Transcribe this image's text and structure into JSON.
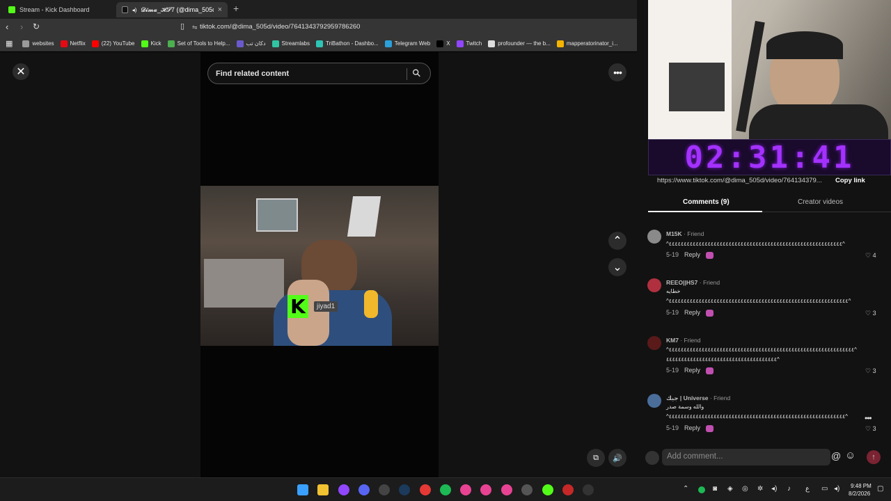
{
  "tabs": [
    {
      "title": "Stream - Kick Dashboard",
      "close": "×"
    },
    {
      "title": "𝓓𝓲𝓶𝓪_𝓗𝓢7 (@dima_505d) | T",
      "close": "×"
    }
  ],
  "new_tab": "+",
  "address": {
    "url": "tiktok.com/@dima_505d/video/7641343792959786260"
  },
  "bookmarks": [
    {
      "label": "websites",
      "color": "#9a9a9a"
    },
    {
      "label": "Netflix",
      "color": "#e50914"
    },
    {
      "label": "(22) YouTube",
      "color": "#ff0000"
    },
    {
      "label": "Kick",
      "color": "#53fc18"
    },
    {
      "label": "Set of Tools to Help...",
      "color": "#4caf50"
    },
    {
      "label": "دكان تب",
      "color": "#6a5acd"
    },
    {
      "label": "Streamlabs",
      "color": "#31c3a2"
    },
    {
      "label": "TriBathon - Dashbo...",
      "color": "#2ec4b6"
    },
    {
      "label": "Telegram Web",
      "color": "#2aa1da"
    },
    {
      "label": "X",
      "color": "#000000"
    },
    {
      "label": "Twitch",
      "color": "#9146ff"
    },
    {
      "label": "profounder — the b...",
      "color": "#dddddd"
    },
    {
      "label": "mapperatorinator_i...",
      "color": "#f4b400"
    }
  ],
  "search": {
    "placeholder": "Find related content"
  },
  "icons": {
    "close": "✕",
    "search": "⚲",
    "more": "•••",
    "up": "⌃",
    "down": "⌄",
    "sound": "🔊",
    "device": "⧉",
    "at": "@",
    "smile": "☺",
    "post": "↑",
    "like": "♡"
  },
  "overlay": {
    "kick_letter": "K",
    "kick_username": "jiyad1"
  },
  "timer": "02:31:41",
  "share": {
    "link": "https://www.tiktok.com/@dima_505d/video/764134379...",
    "copy_label": "Copy link"
  },
  "panel_tabs": {
    "comments": "Comments (9)",
    "creator": "Creator videos"
  },
  "comments": [
    {
      "user": "M15K",
      "relation": "· Friend",
      "lines": [
        "^٤٤٤٤٤٤٤٤٤٤٤٤٤٤٤٤٤٤٤٤٤٤٤٤٤٤٤٤٤٤٤٤٤٤٤٤٤٤٤٤٤٤٤٤٤٤٤٤٤٤٤٤٤٤٤٤٤٤^"
      ],
      "date": "5-19",
      "reply": "Reply",
      "likes": "4",
      "avatar_color": "#8a8a8a"
    },
    {
      "user": "REEO||HS7",
      "relation": "· Friend",
      "lines": [
        "خطايه",
        "^٤٤٤٤٤٤٤٤٤٤٤٤٤٤٤٤٤٤٤٤٤٤٤٤٤٤٤٤٤٤٤٤٤٤٤٤٤٤٤٤٤٤٤٤٤٤٤٤٤٤٤٤٤٤٤٤٤٤٤٤^"
      ],
      "date": "5-19",
      "reply": "Reply",
      "likes": "3",
      "avatar_color": "#b0303f"
    },
    {
      "user": "KM7",
      "relation": "· Friend",
      "lines": [
        "^٤٤٤٤٤٤٤٤٤٤٤٤٤٤٤٤٤٤٤٤٤٤٤٤٤٤٤٤٤٤٤٤٤٤٤٤٤٤٤٤٤٤٤٤٤٤٤٤٤٤٤٤٤٤٤٤٤٤٤٤٤٤^",
        "٤٤٤٤٤٤٤٤٤٤٤٤٤٤٤٤٤٤٤٤٤٤٤٤٤٤٤٤٤٤٤٤٤٤٤٤٤^"
      ],
      "date": "5-19",
      "reply": "Reply",
      "likes": "3",
      "avatar_color": "#5a1a1a"
    },
    {
      "user": "جيك | Universe",
      "relation": "· Friend",
      "lines": [
        "والله وسمة صدر",
        "^٤٤٤٤٤٤٤٤٤٤٤٤٤٤٤٤٤٤٤٤٤٤٤٤٤٤٤٤٤٤٤٤٤٤٤٤٤٤٤٤٤٤٤٤٤٤٤٤٤٤٤٤٤٤٤٤٤٤٤^"
      ],
      "date": "5-19",
      "reply": "Reply",
      "likes": "3",
      "avatar_color": "#4a6d9a"
    }
  ],
  "add_comment": {
    "placeholder": "Add comment..."
  },
  "taskbar": {
    "apps": [
      {
        "name": "start",
        "color": "#3aa0ff"
      },
      {
        "name": "explorer",
        "color": "#f1c232"
      },
      {
        "name": "twitch-studio",
        "color": "#9146ff"
      },
      {
        "name": "discord",
        "color": "#5865f2"
      },
      {
        "name": "obs",
        "color": "#444444"
      },
      {
        "name": "steam",
        "color": "#1b3a5c"
      },
      {
        "name": "app-red",
        "color": "#e53935"
      },
      {
        "name": "spotify",
        "color": "#1db954"
      },
      {
        "name": "app-pink-1",
        "color": "#e84393"
      },
      {
        "name": "app-pink-2",
        "color": "#e84393"
      },
      {
        "name": "app-pink-3",
        "color": "#e84393"
      },
      {
        "name": "app-dark",
        "color": "#555555"
      },
      {
        "name": "kick",
        "color": "#53fc18"
      },
      {
        "name": "app-red-2",
        "color": "#c62828"
      },
      {
        "name": "terminal",
        "color": "#333333"
      }
    ],
    "tray_lang": "ع",
    "time": "9:48 PM",
    "date": "8/2/2026"
  }
}
